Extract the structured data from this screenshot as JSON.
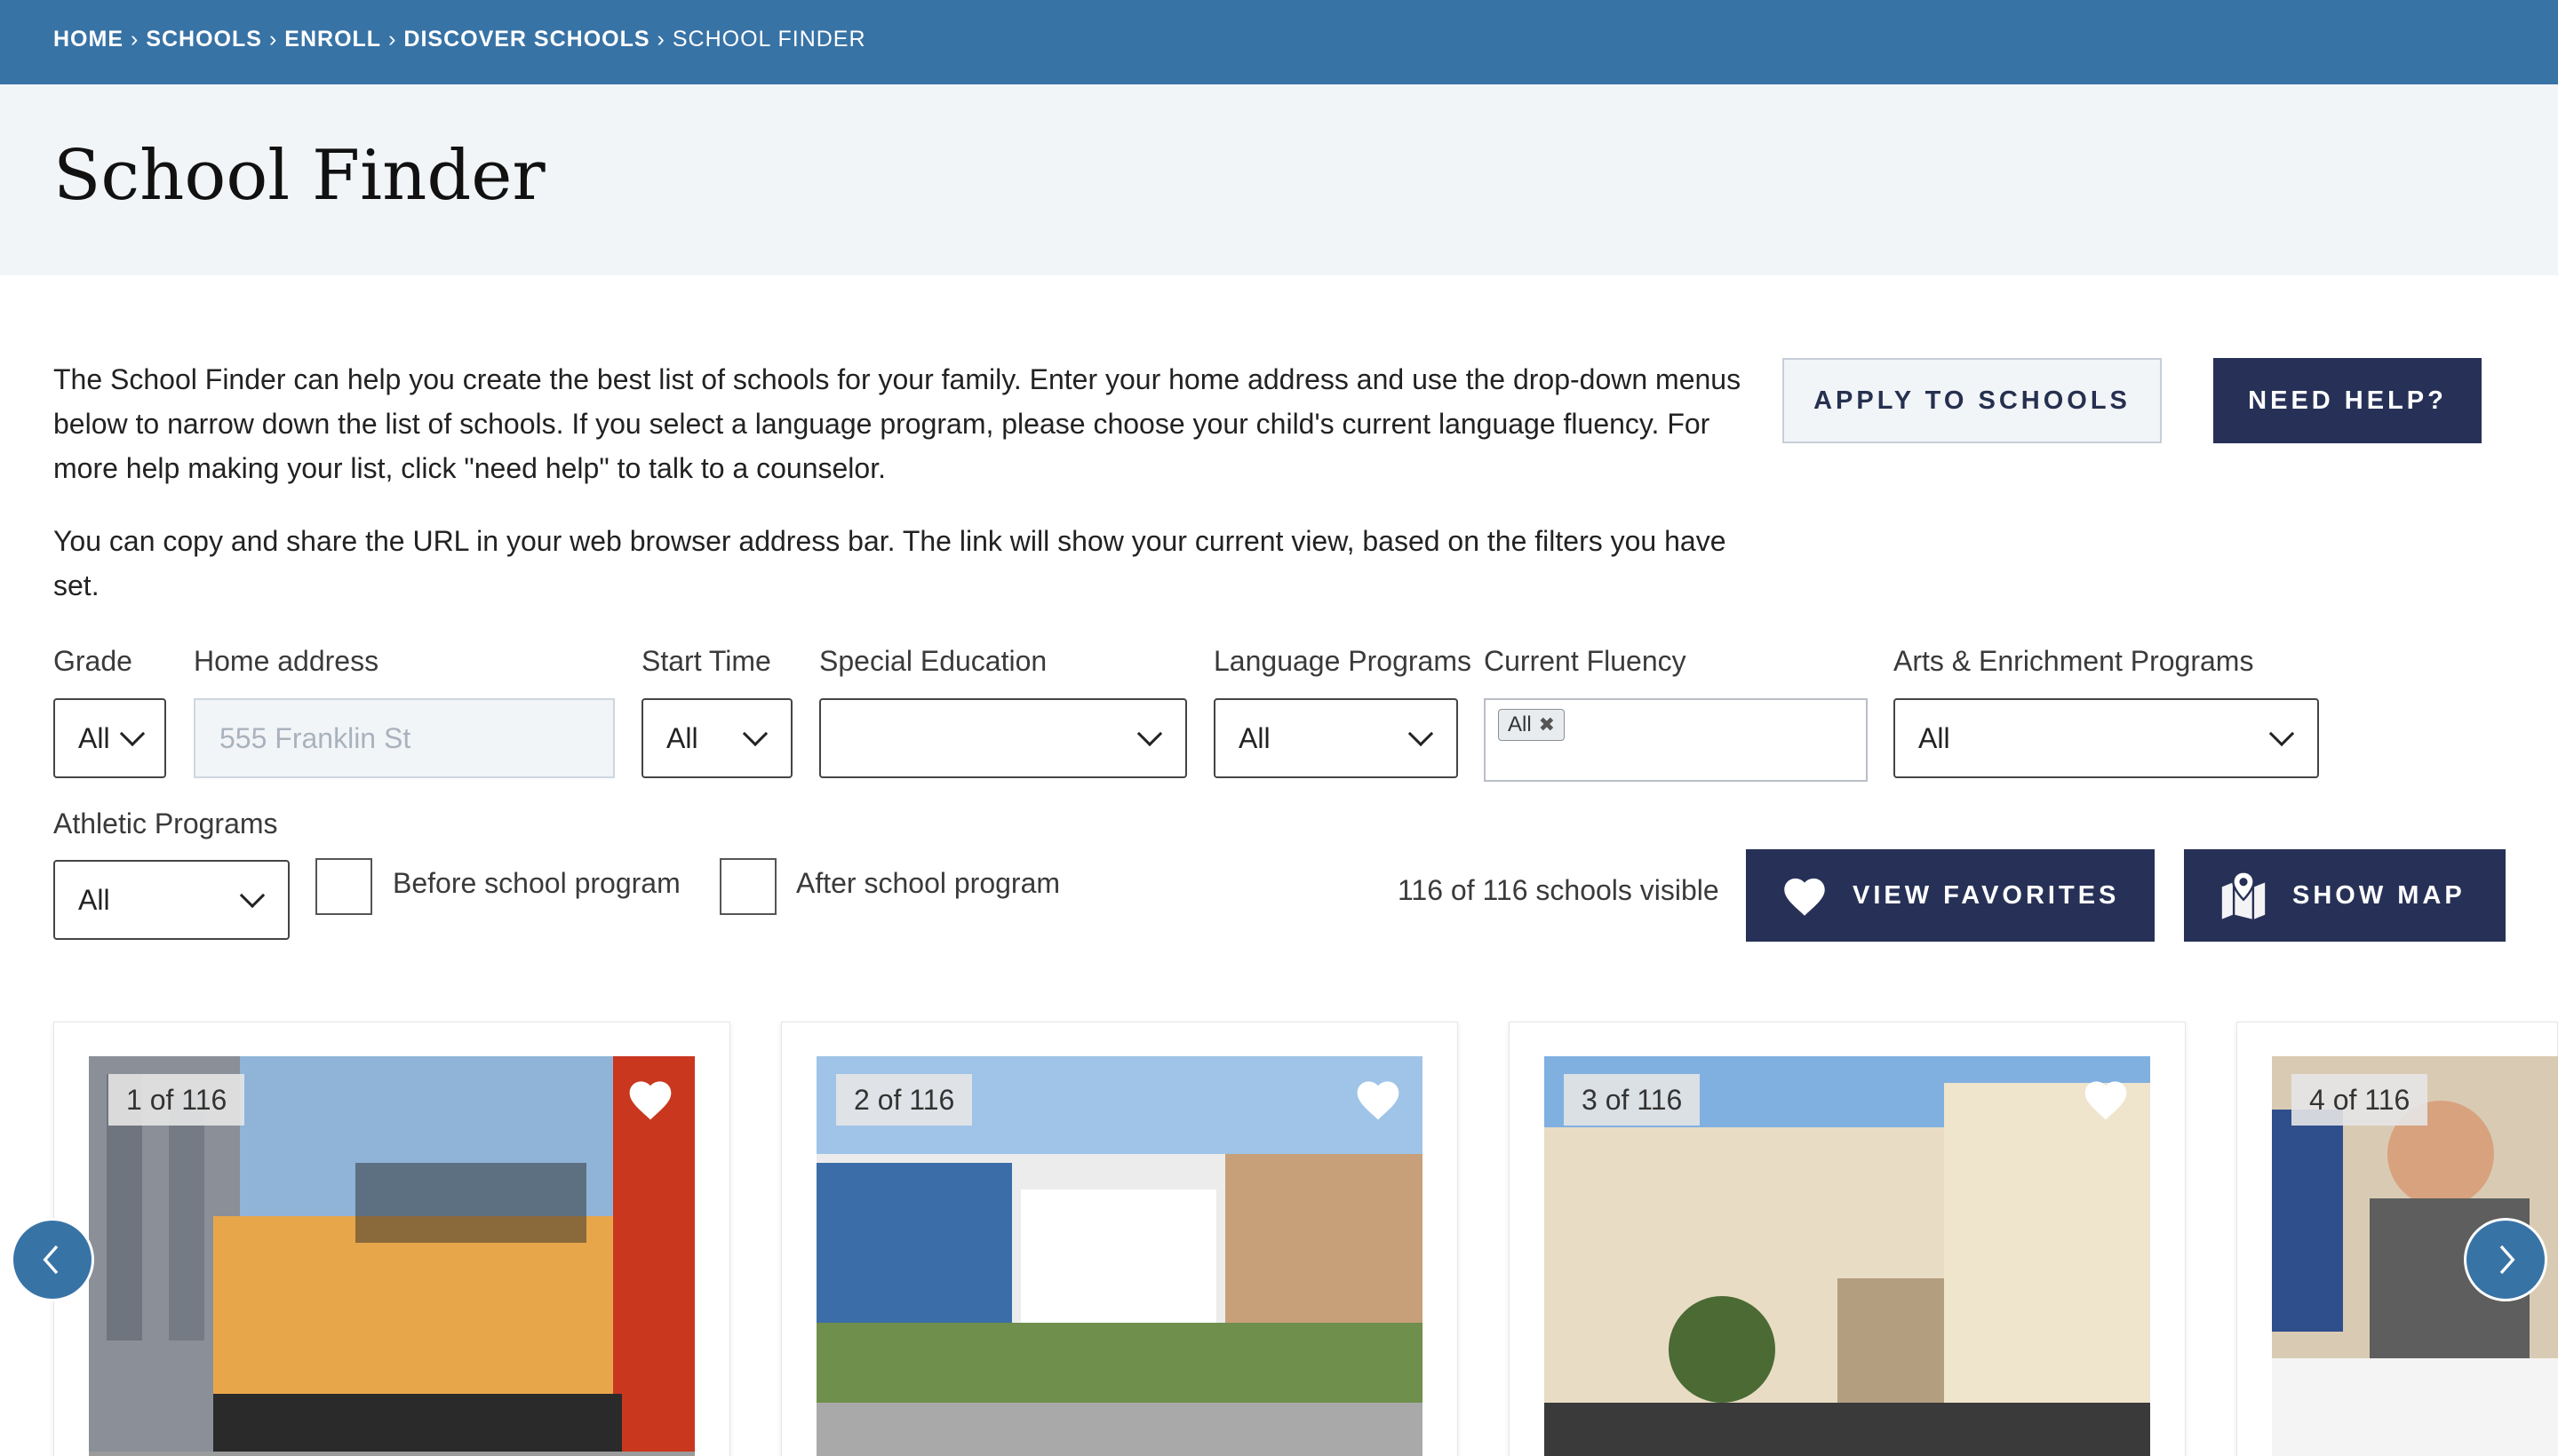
{
  "breadcrumb": {
    "home": "HOME",
    "schools": "SCHOOLS",
    "enroll": "ENROLL",
    "discover": "DISCOVER SCHOOLS",
    "current": "SCHOOL FINDER",
    "separator": "›"
  },
  "page_title": "School Finder",
  "intro": {
    "paragraph1": "The School Finder can help you create the best list of schools for your family. Enter your home address and use the drop-down menus below to narrow down the list of schools. If you select a language program, please choose your child's current language fluency. For more help making your list, click \"need help\" to talk to a counselor.",
    "paragraph2": "You can copy and share the URL in your web browser address bar. The link will show your current view, based on the filters you have set."
  },
  "actions": {
    "apply_label": "APPLY TO SCHOOLS",
    "help_label": "NEED HELP?"
  },
  "filters": {
    "grade": {
      "label": "Grade",
      "value": "All"
    },
    "home_address": {
      "label": "Home address",
      "value": "",
      "placeholder": "555 Franklin St"
    },
    "start_time": {
      "label": "Start Time",
      "value": "All"
    },
    "special_education": {
      "label": "Special Education",
      "value": ""
    },
    "language_programs": {
      "label": "Language Programs",
      "value": "All"
    },
    "current_fluency": {
      "label": "Current Fluency",
      "tag": "All",
      "remove_glyph": "✖"
    },
    "arts_enrichment": {
      "label": "Arts & Enrichment Programs",
      "value": "All"
    },
    "athletic_programs": {
      "label": "Athletic Programs",
      "value": "All"
    },
    "before_school": {
      "label": "Before school program",
      "checked": false
    },
    "after_school": {
      "label": "After school program",
      "checked": false
    }
  },
  "results": {
    "visible_text": "116 of 116 schools visible",
    "view_favorites_label": "VIEW FAVORITES",
    "show_map_label": "SHOW MAP"
  },
  "cards": [
    {
      "counter": "1 of 116"
    },
    {
      "counter": "2 of 116"
    },
    {
      "counter": "3 of 116"
    },
    {
      "counter": "4 of 116"
    }
  ],
  "colors": {
    "breadcrumb_bar": "#3873a6",
    "title_band": "#f2f5f8",
    "navy_button": "#273157",
    "nav_arrow": "#3873a6"
  }
}
